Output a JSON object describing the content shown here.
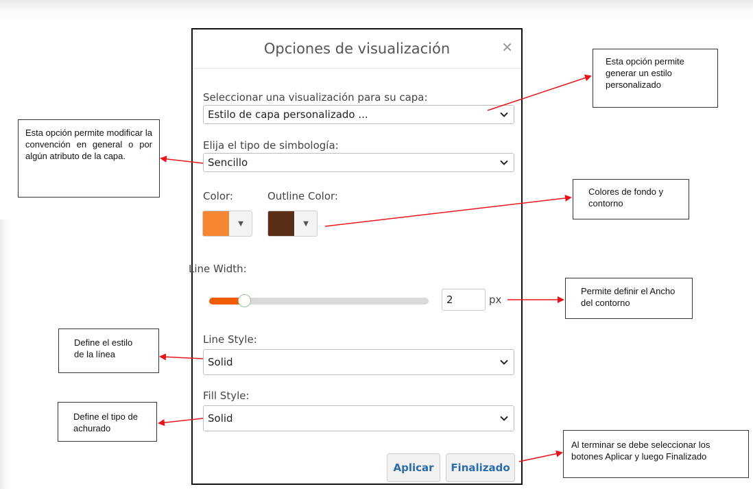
{
  "dialog": {
    "title": "Opciones de visualización",
    "close_glyph": "✕",
    "visualization": {
      "label": "Seleccionar una visualización para su capa:",
      "selected": "Estilo de capa personalizado ..."
    },
    "symbology": {
      "label": "Elija el tipo de simbología:",
      "selected": "Sencillo"
    },
    "color": {
      "label": "Color:",
      "value": "#f58632"
    },
    "outline_color": {
      "label": "Outline Color:",
      "value": "#5a2e17"
    },
    "line_width": {
      "label": "Line Width:",
      "value": "2",
      "unit": "px",
      "slider_fraction": 0.16,
      "accent": "#f25c05"
    },
    "line_style": {
      "label": "Line Style:",
      "selected": "Solid"
    },
    "fill_style": {
      "label": "Fill Style:",
      "selected": "Solid"
    },
    "buttons": {
      "apply": "Aplicar",
      "finish": "Finalizado"
    }
  },
  "annotations": {
    "custom_style": "Esta opción permite generar un estilo personalizado",
    "symbology": "Esta opción permite modificar la convención en general o por algún atributo de la capa.",
    "colors": "Colores de fondo y contorno",
    "width": "Permite definir el Ancho del contorno",
    "line_style": "Define el estilo de la línea",
    "fill": "Define el tipo de achurado",
    "finish": "Al terminar se debe seleccionar los botones Aplicar y luego Finalizado"
  },
  "arrow_color": "#e8141a"
}
